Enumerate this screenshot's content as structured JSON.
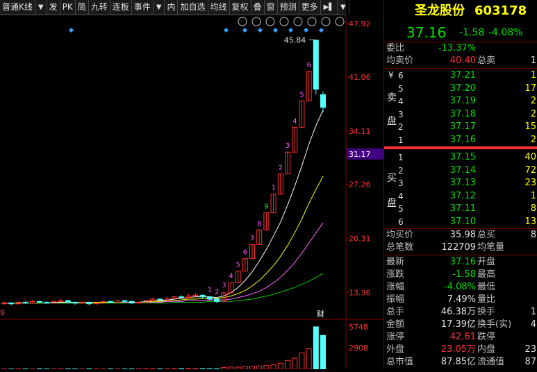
{
  "toolbar": {
    "items": [
      "普通K线",
      "▼",
      "发",
      "PK",
      "简",
      "九转",
      "连板",
      "事件",
      "▼",
      "内",
      "加自选",
      "均线",
      "复权",
      "叠",
      "窗",
      "预测",
      "更多",
      "▶▌",
      "▼"
    ]
  },
  "chart": {
    "price_labels": [
      "47.92",
      "41.06",
      "34.11",
      "31.17",
      "27.26",
      "20.31",
      "13.36"
    ],
    "current_price_tag": "31.17",
    "high_label": "45.84",
    "volume_labels": [
      "5748",
      "2908"
    ],
    "event_marker": "财",
    "left_edge_label": "9",
    "candle_numbers": [
      "1",
      "2",
      "3",
      "4",
      "5",
      "6",
      "7",
      "8",
      "9",
      "1",
      "2",
      "3",
      "4",
      "5",
      "6"
    ],
    "tool_icons": [
      "eye",
      "hand",
      "play",
      "step",
      "scissors",
      "settings",
      "zoom-in",
      "zoom-out"
    ]
  },
  "chart_data": {
    "type": "candlestick",
    "ylim": [
      10.0,
      49.0
    ],
    "y_ticks": [
      47.92,
      41.06,
      34.11,
      31.17,
      27.26,
      20.31,
      13.36
    ],
    "candles": [
      {
        "o": 11.9,
        "c": 12.0,
        "h": 12.2,
        "l": 11.8
      },
      {
        "o": 12.0,
        "c": 11.9,
        "h": 12.1,
        "l": 11.7
      },
      {
        "o": 11.9,
        "c": 12.1,
        "h": 12.2,
        "l": 11.8
      },
      {
        "o": 12.1,
        "c": 12.0,
        "h": 12.3,
        "l": 11.9
      },
      {
        "o": 12.0,
        "c": 12.2,
        "h": 12.4,
        "l": 11.9
      },
      {
        "o": 12.2,
        "c": 12.1,
        "h": 12.3,
        "l": 12.0
      },
      {
        "o": 12.1,
        "c": 12.0,
        "h": 12.2,
        "l": 11.9
      },
      {
        "o": 12.0,
        "c": 12.2,
        "h": 12.3,
        "l": 11.9
      },
      {
        "o": 12.2,
        "c": 12.3,
        "h": 12.5,
        "l": 12.1
      },
      {
        "o": 12.3,
        "c": 12.1,
        "h": 12.4,
        "l": 12.0
      },
      {
        "o": 12.1,
        "c": 12.0,
        "h": 12.2,
        "l": 11.8
      },
      {
        "o": 12.0,
        "c": 12.1,
        "h": 12.2,
        "l": 11.9
      },
      {
        "o": 12.1,
        "c": 11.9,
        "h": 12.2,
        "l": 11.7
      },
      {
        "o": 11.9,
        "c": 12.0,
        "h": 12.1,
        "l": 11.8
      },
      {
        "o": 12.0,
        "c": 12.2,
        "h": 12.3,
        "l": 11.9
      },
      {
        "o": 12.2,
        "c": 12.1,
        "h": 12.3,
        "l": 12.0
      },
      {
        "o": 12.1,
        "c": 12.3,
        "h": 12.4,
        "l": 12.0
      },
      {
        "o": 12.3,
        "c": 12.2,
        "h": 12.4,
        "l": 12.1
      },
      {
        "o": 12.2,
        "c": 12.0,
        "h": 12.3,
        "l": 11.9
      },
      {
        "o": 12.0,
        "c": 12.1,
        "h": 12.2,
        "l": 11.9
      },
      {
        "o": 12.1,
        "c": 12.3,
        "h": 12.4,
        "l": 12.0
      },
      {
        "o": 12.3,
        "c": 12.5,
        "h": 12.7,
        "l": 12.2
      },
      {
        "o": 12.5,
        "c": 12.4,
        "h": 12.6,
        "l": 12.3
      },
      {
        "o": 12.4,
        "c": 12.6,
        "h": 12.8,
        "l": 12.3
      },
      {
        "o": 12.6,
        "c": 12.8,
        "h": 12.9,
        "l": 12.5
      },
      {
        "o": 12.8,
        "c": 12.7,
        "h": 13.0,
        "l": 12.6
      },
      {
        "o": 12.7,
        "c": 12.9,
        "h": 13.2,
        "l": 12.6
      },
      {
        "o": 12.9,
        "c": 13.0,
        "h": 13.3,
        "l": 12.8
      },
      {
        "o": 13.0,
        "c": 12.8,
        "h": 13.1,
        "l": 12.6
      },
      {
        "o": 12.8,
        "c": 12.5,
        "h": 12.9,
        "l": 12.3
      },
      {
        "o": 12.5,
        "c": 12.2,
        "h": 12.6,
        "l": 12.0
      },
      {
        "o": 12.2,
        "c": 13.3,
        "h": 13.5,
        "l": 12.1
      },
      {
        "o": 13.3,
        "c": 14.6,
        "h": 14.7,
        "l": 13.3
      },
      {
        "o": 14.6,
        "c": 16.1,
        "h": 16.1,
        "l": 14.6
      },
      {
        "o": 16.1,
        "c": 17.7,
        "h": 17.7,
        "l": 16.1
      },
      {
        "o": 17.7,
        "c": 19.5,
        "h": 19.5,
        "l": 17.7
      },
      {
        "o": 19.5,
        "c": 21.4,
        "h": 21.4,
        "l": 19.5
      },
      {
        "o": 21.4,
        "c": 23.6,
        "h": 23.6,
        "l": 21.4
      },
      {
        "o": 23.6,
        "c": 26.0,
        "h": 26.0,
        "l": 23.6
      },
      {
        "o": 26.0,
        "c": 28.6,
        "h": 28.6,
        "l": 26.0
      },
      {
        "o": 28.6,
        "c": 31.4,
        "h": 31.4,
        "l": 28.6
      },
      {
        "o": 31.4,
        "c": 34.6,
        "h": 34.6,
        "l": 31.4
      },
      {
        "o": 34.6,
        "c": 38.0,
        "h": 38.0,
        "l": 34.6
      },
      {
        "o": 38.0,
        "c": 41.8,
        "h": 41.8,
        "l": 38.0
      },
      {
        "o": 45.8,
        "c": 39.5,
        "h": 45.84,
        "l": 38.8
      },
      {
        "o": 38.8,
        "c": 37.16,
        "h": 39.2,
        "l": 36.5
      }
    ],
    "ma_lines": [
      {
        "color": "#ffffff",
        "values": [
          12.0,
          12.0,
          12.0,
          12.0,
          12.0,
          12.0,
          12.0,
          12.1,
          12.1,
          12.1,
          12.1,
          12.1,
          12.1,
          12.0,
          12.0,
          12.1,
          12.1,
          12.1,
          12.1,
          12.1,
          12.2,
          12.3,
          12.3,
          12.4,
          12.5,
          12.6,
          12.7,
          12.8,
          12.8,
          12.8,
          12.7,
          12.9,
          13.3,
          14.0,
          14.9,
          16.0,
          17.4,
          18.9,
          20.6,
          22.4,
          24.6,
          27.0,
          29.6,
          32.4,
          34.8,
          36.8
        ]
      },
      {
        "color": "#ffff00",
        "values": [
          12.0,
          12.0,
          12.0,
          12.0,
          12.0,
          12.0,
          12.0,
          12.0,
          12.0,
          12.0,
          12.0,
          12.0,
          12.1,
          12.1,
          12.1,
          12.1,
          12.1,
          12.1,
          12.1,
          12.1,
          12.1,
          12.2,
          12.2,
          12.3,
          12.3,
          12.4,
          12.5,
          12.5,
          12.6,
          12.6,
          12.6,
          12.7,
          12.9,
          13.2,
          13.6,
          14.2,
          14.9,
          15.8,
          16.8,
          18.0,
          19.4,
          21.0,
          22.8,
          24.8,
          26.6,
          28.3
        ]
      },
      {
        "color": "#ff66ff",
        "values": [
          12.0,
          12.0,
          12.0,
          12.0,
          12.0,
          12.0,
          12.0,
          12.0,
          12.0,
          12.0,
          12.0,
          12.0,
          12.0,
          12.0,
          12.0,
          12.0,
          12.0,
          12.1,
          12.1,
          12.1,
          12.1,
          12.1,
          12.1,
          12.2,
          12.2,
          12.2,
          12.3,
          12.3,
          12.3,
          12.4,
          12.4,
          12.4,
          12.5,
          12.7,
          12.9,
          13.2,
          13.5,
          14.0,
          14.6,
          15.3,
          16.2,
          17.2,
          18.4,
          19.7,
          21.0,
          22.3
        ]
      },
      {
        "color": "#00cc00",
        "values": [
          12.0,
          12.0,
          12.0,
          12.0,
          12.0,
          12.0,
          12.0,
          12.0,
          12.0,
          12.0,
          12.0,
          12.0,
          12.0,
          12.0,
          12.0,
          12.0,
          12.0,
          12.0,
          12.0,
          12.0,
          12.0,
          12.0,
          12.0,
          12.0,
          12.1,
          12.1,
          12.1,
          12.1,
          12.1,
          12.2,
          12.2,
          12.2,
          12.2,
          12.3,
          12.4,
          12.5,
          12.7,
          12.9,
          13.1,
          13.4,
          13.7,
          14.0,
          14.4,
          14.8,
          15.3,
          15.8
        ]
      }
    ],
    "volume_ylim": [
      0,
      6400
    ],
    "volumes": [
      40,
      30,
      50,
      45,
      35,
      60,
      40,
      30,
      50,
      45,
      40,
      35,
      55,
      40,
      45,
      50,
      35,
      40,
      45,
      50,
      60,
      70,
      55,
      60,
      80,
      70,
      90,
      85,
      70,
      65,
      60,
      250,
      300,
      280,
      350,
      400,
      450,
      500,
      600,
      800,
      1200,
      1500,
      2200,
      2800,
      5748,
      4600
    ]
  },
  "quote": {
    "name": "圣龙股份",
    "code": "603178",
    "price": "37.16",
    "change": "-1.58",
    "change_pct": "-4.08%",
    "weibi_label": "委比",
    "weibi": "-13.37%",
    "avg_sell_label": "均卖价",
    "avg_sell": "40.40",
    "total_sell_label": "总卖",
    "sell_group_label_1": "卖",
    "sell_group_label_2": "盘",
    "buy_group_label_1": "买",
    "buy_group_label_2": "盘",
    "yen_symbol": "¥",
    "sells": [
      {
        "lv": "6",
        "price": "37.21",
        "vol": "1"
      },
      {
        "lv": "5",
        "price": "37.20",
        "vol": "17"
      },
      {
        "lv": "4",
        "price": "37.19",
        "vol": "2"
      },
      {
        "lv": "3",
        "price": "37.18",
        "vol": "2"
      },
      {
        "lv": "2",
        "price": "37.17",
        "vol": "15"
      },
      {
        "lv": "1",
        "price": "37.16",
        "vol": "2"
      }
    ],
    "buys": [
      {
        "lv": "1",
        "price": "37.15",
        "vol": "40"
      },
      {
        "lv": "2",
        "price": "37.14",
        "vol": "72"
      },
      {
        "lv": "3",
        "price": "37.13",
        "vol": "23"
      },
      {
        "lv": "4",
        "price": "37.12",
        "vol": "1"
      },
      {
        "lv": "5",
        "price": "37.11",
        "vol": "8"
      },
      {
        "lv": "6",
        "price": "37.10",
        "vol": "13"
      }
    ],
    "avg_buy_label": "均买价",
    "avg_buy": "35.98",
    "total_buy_label": "总买",
    "total_buy": "8",
    "deals_label": "总笔数",
    "deals": "122709",
    "avg_deal_label": "均笔量",
    "stats": [
      {
        "l1": "最新",
        "v1": "37.16",
        "c1": "grn",
        "l2": "开盘",
        "v2": ""
      },
      {
        "l1": "涨跌",
        "v1": "-1.58",
        "c1": "grn",
        "l2": "最高",
        "v2": ""
      },
      {
        "l1": "涨幅",
        "v1": "-4.08%",
        "c1": "grn",
        "l2": "最低",
        "v2": ""
      },
      {
        "l1": "振幅",
        "v1": "7.49%",
        "c1": "wht",
        "l2": "量比",
        "v2": ""
      },
      {
        "l1": "总手",
        "v1": "46.38万",
        "c1": "wht",
        "l2": "换手",
        "v2": "1"
      },
      {
        "l1": "金额",
        "v1": "17.39亿",
        "c1": "wht",
        "l2": "换手(实)",
        "v2": "4"
      },
      {
        "l1": "涨停",
        "v1": "42.61",
        "c1": "red",
        "l2": "跌停",
        "v2": ""
      },
      {
        "l1": "外盘",
        "v1": "23.05万",
        "c1": "red",
        "l2": "内盘",
        "v2": "23"
      },
      {
        "l1": "总市值",
        "v1": "87.85亿",
        "c1": "wht",
        "l2": "流通值",
        "v2": "87"
      }
    ]
  },
  "colors": {
    "up": "#ff3232",
    "down": "#54ffff",
    "bg": "#000000",
    "frame": "#800000"
  }
}
